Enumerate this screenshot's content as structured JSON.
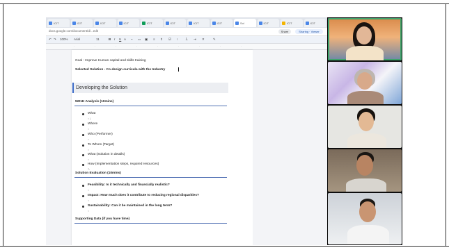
{
  "browser": {
    "tabs": [
      {
        "label": "ICIT"
      },
      {
        "label": "ICIT"
      },
      {
        "label": "ICIT"
      },
      {
        "label": "ICIT"
      },
      {
        "label": "ICIT"
      },
      {
        "label": "ICIT"
      },
      {
        "label": "ICIT"
      },
      {
        "label": "ICIT"
      },
      {
        "label": "Sol"
      },
      {
        "label": "ICIT"
      },
      {
        "label": "ICIT"
      },
      {
        "label": "ICIT"
      }
    ],
    "url": "docs.google.com/document/d/...edit",
    "share_label": "Share",
    "account_label": "Sharing · Viewer"
  },
  "docs_toolbar": {
    "zoom": "100%",
    "style": "Arial",
    "font_size": "11"
  },
  "document": {
    "goal_line": "Goal : Improve Human capital and skills training",
    "selected_solution": "Selected Solution - Co-design curricula with the Industry",
    "section_heading": "Developing the Solution",
    "analysis_title": "5W1H Analysis (10mins)",
    "w_items": [
      "What",
      "Where",
      "Who (Performer)",
      "To Whom (Target)",
      "What (Solution in details)",
      "How (Implementation steps, required resources)"
    ],
    "evaluation_title": "Solution Evaluation (10mins)",
    "eval_items": [
      "Feasibility: Is it technically and financially realistic?",
      "Impact: How much does it contribute to reducing regional disparities?",
      "Sustainability: Can it be maintained in the long term?"
    ],
    "supporting_title": "Supporting Data (if you have time)"
  },
  "participants": [
    {
      "id": "p1",
      "speaking": true
    },
    {
      "id": "p2",
      "speaking": false
    },
    {
      "id": "p3",
      "speaking": false
    },
    {
      "id": "p4",
      "speaking": false
    },
    {
      "id": "p5",
      "speaking": false
    }
  ],
  "colors": {
    "accent": "#3c6bc7",
    "speaking_border": "#3ea36b"
  }
}
